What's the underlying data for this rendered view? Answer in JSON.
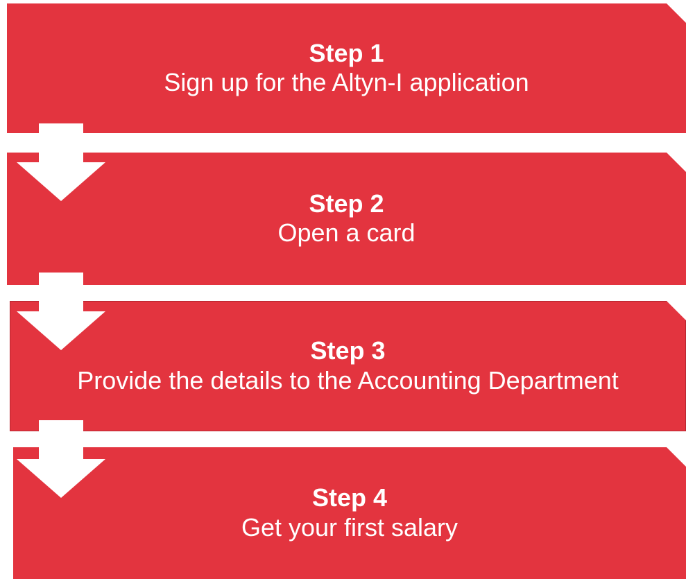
{
  "colors": {
    "step_fill": "#e3343f",
    "arrow_fill": "#ffffff",
    "text": "#ffffff"
  },
  "steps": [
    {
      "title": "Step 1",
      "description": "Sign up for the Altyn-I application"
    },
    {
      "title": "Step 2",
      "description": "Open a card"
    },
    {
      "title": "Step 3",
      "description": "Provide the details to the Accounting Department"
    },
    {
      "title": "Step 4",
      "description": "Get your first salary"
    }
  ],
  "arrows": [
    {
      "icon": "arrow-down-icon"
    },
    {
      "icon": "arrow-down-icon"
    },
    {
      "icon": "arrow-down-icon"
    }
  ]
}
